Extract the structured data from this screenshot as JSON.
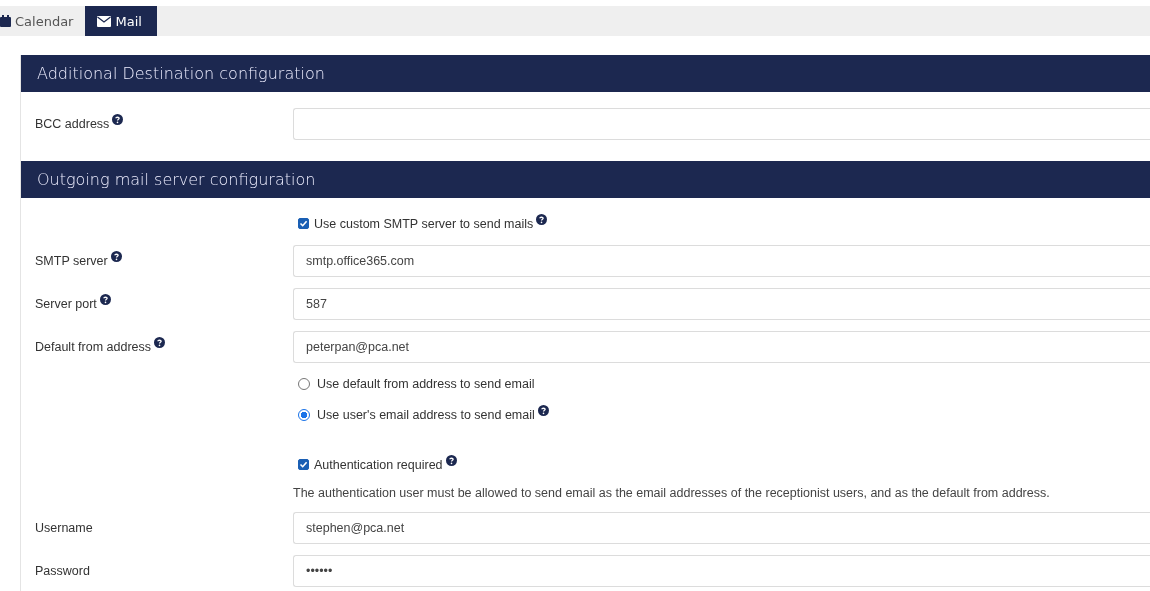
{
  "tabs": [
    {
      "label": "Calendar",
      "selected": false
    },
    {
      "label": "Mail",
      "selected": true
    }
  ],
  "sections": [
    {
      "title": "Additional Destination configuration",
      "rows": [
        {
          "kind": "field",
          "label": "BCC address",
          "help": true
        }
      ]
    },
    {
      "title": "Outgoing mail server configuration",
      "rows": [
        {
          "kind": "checkbox",
          "label": "Use custom SMTP server to send mails",
          "checked": true,
          "help": true
        },
        {
          "kind": "field",
          "label": "SMTP server",
          "help": true,
          "value": "smtp.office365.com"
        },
        {
          "kind": "field",
          "label": "Server port",
          "help": true,
          "value": "587"
        },
        {
          "kind": "field",
          "label": "Default from address",
          "help": true,
          "value": "peterpan@pca.net"
        },
        {
          "kind": "radio",
          "label": "Use default from address to send email",
          "selected": false,
          "help": false
        },
        {
          "kind": "radio",
          "label": "Use user's email address to send email",
          "selected": true,
          "help": true
        },
        {
          "kind": "checkbox",
          "label": "Authentication required",
          "checked": true,
          "help": true
        },
        {
          "kind": "note",
          "text": "The authentication user must be allowed to send email as the email addresses of the receptionist users, and as the default from address."
        },
        {
          "kind": "field",
          "label": "Username",
          "help": false,
          "value": "stephen@pca.net"
        },
        {
          "kind": "field",
          "label": "Password",
          "help": false,
          "value": "••••••"
        }
      ]
    }
  ]
}
